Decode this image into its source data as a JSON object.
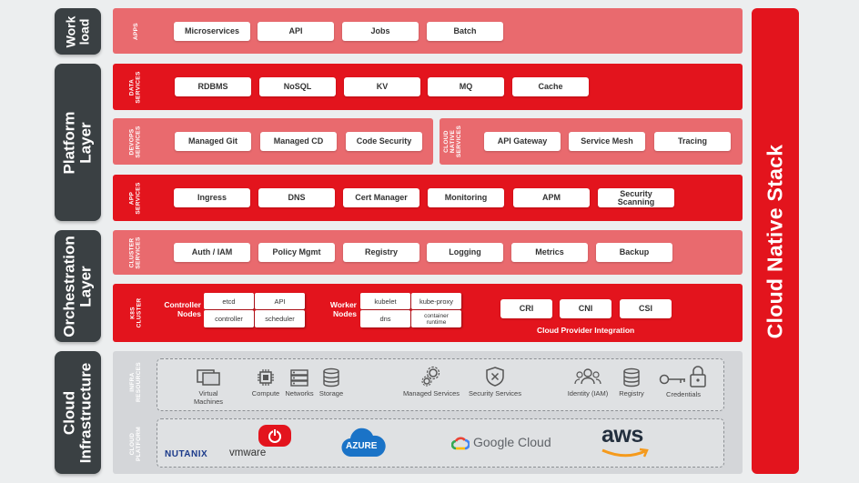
{
  "layers": {
    "workload": "Work\nload",
    "platform": "Platform\nLayer",
    "orchestration": "Orchestration\nLayer",
    "infrastructure": "Cloud\nInfrastructure"
  },
  "stack_title": "Cloud Native Stack",
  "apps": {
    "label": "APPS",
    "items": [
      "Microservices",
      "API",
      "Jobs",
      "Batch"
    ]
  },
  "data_services": {
    "label": "DATA\nSERVICES",
    "items": [
      "RDBMS",
      "NoSQL",
      "KV",
      "MQ",
      "Cache"
    ]
  },
  "devops_services": {
    "label": "DEVOPS\nSERVICES",
    "items": [
      "Managed Git",
      "Managed CD",
      "Code Security"
    ]
  },
  "cloud_native_services": {
    "label": "CLOUD\nNATIVE\nSERVICES",
    "items": [
      "API Gateway",
      "Service Mesh",
      "Tracing"
    ]
  },
  "app_services": {
    "label": "APP\nSERVICES",
    "items": [
      "Ingress",
      "DNS",
      "Cert Manager",
      "Monitoring",
      "APM",
      "Security\nScanning"
    ]
  },
  "cluster_services": {
    "label": "CLUSTER\nSERVICES",
    "items": [
      "Auth / IAM",
      "Policy Mgmt",
      "Registry",
      "Logging",
      "Metrics",
      "Backup"
    ]
  },
  "k8s_cluster": {
    "label": "K8S\nCLUSTER",
    "controller_label": "Controller\nNodes",
    "controller": [
      "etcd",
      "API",
      "controller",
      "scheduler"
    ],
    "worker_label": "Worker\nNodes",
    "worker": [
      "kubelet",
      "kube-proxy",
      "dns",
      "container\nruntime"
    ],
    "interfaces": [
      "CRI",
      "CNI",
      "CSI"
    ],
    "cloud_provider_integration": "Cloud Provider Integration"
  },
  "infra_resources": {
    "label": "INFRA\nRESOURCES",
    "items": [
      {
        "name": "Virtual\nMachines",
        "icon": "virtual-machines-icon"
      },
      {
        "name": "Compute",
        "icon": "compute-chip-icon"
      },
      {
        "name": "Networks",
        "icon": "network-switch-icon"
      },
      {
        "name": "Storage",
        "icon": "database-storage-icon"
      },
      {
        "name": "Managed Services",
        "icon": "gears-icon"
      },
      {
        "name": "Security Services",
        "icon": "shield-icon"
      },
      {
        "name": "Identity (IAM)",
        "icon": "users-icon"
      },
      {
        "name": "Registry",
        "icon": "database-icon"
      },
      {
        "name": "Credentials",
        "icon": "key-lock-icon"
      }
    ]
  },
  "cloud_platform": {
    "label": "CLOUD\nPLATFORM",
    "logos": {
      "nutanix": "NUTANIX",
      "vmware": "vmware",
      "azure": "AZURE",
      "google": "Google Cloud",
      "aws": "aws"
    }
  },
  "colors": {
    "red": "#e3141d",
    "light_red": "#e96a6e",
    "dark_slate": "#3a4043",
    "grey_band": "#d4d6d9"
  }
}
